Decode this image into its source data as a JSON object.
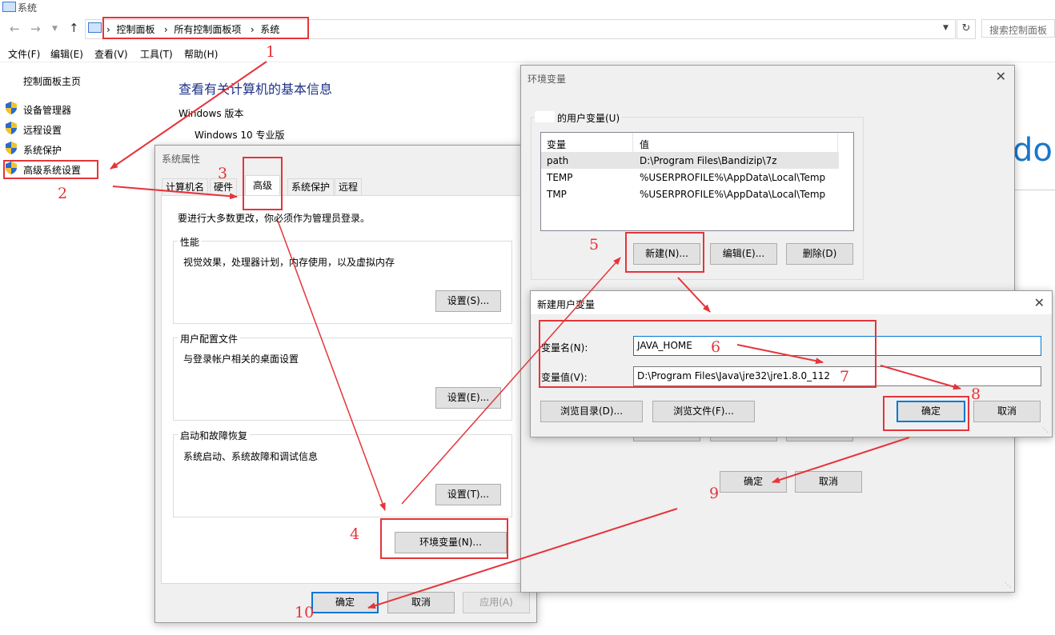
{
  "window": {
    "title": "系统",
    "breadcrumb": [
      "控制面板",
      "所有控制面板项",
      "系统"
    ],
    "search_placeholder": "搜索控制面板",
    "menu": [
      "文件(F)",
      "编辑(E)",
      "查看(V)",
      "工具(T)",
      "帮助(H)"
    ]
  },
  "sidebar": {
    "home": "控制面板主页",
    "links": [
      "设备管理器",
      "远程设置",
      "系统保护",
      "高级系统设置"
    ]
  },
  "main": {
    "heading": "查看有关计算机的基本信息",
    "section": "Windows 版本",
    "edition": "Windows 10 专业版",
    "brand_fragment": "do"
  },
  "system_properties": {
    "title": "系统属性",
    "tabs": [
      "计算机名",
      "硬件",
      "高级",
      "系统保护",
      "远程"
    ],
    "admin_note": "要进行大多数更改，你必须作为管理员登录。",
    "performance": {
      "label": "性能",
      "desc": "视觉效果，处理器计划，内存使用，以及虚拟内存",
      "button": "设置(S)..."
    },
    "profile": {
      "label": "用户配置文件",
      "desc": "与登录帐户相关的桌面设置",
      "button": "设置(E)..."
    },
    "startup": {
      "label": "启动和故障恢复",
      "desc": "系统启动、系统故障和调试信息",
      "button": "设置(T)..."
    },
    "env_button": "环境变量(N)...",
    "ok": "确定",
    "cancel": "取消",
    "apply": "应用(A)"
  },
  "env_vars": {
    "title": "环境变量",
    "user_group_label": "的用户变量(U)",
    "col_var": "变量",
    "col_val": "值",
    "rows": [
      {
        "var": "path",
        "val": "D:\\Program Files\\Bandizip\\7z"
      },
      {
        "var": "TEMP",
        "val": "%USERPROFILE%\\AppData\\Local\\Temp"
      },
      {
        "var": "TMP",
        "val": "%USERPROFILE%\\AppData\\Local\\Temp"
      }
    ],
    "new_btn": "新建(N)...",
    "edit_btn": "编辑(E)...",
    "delete_btn": "删除(D)",
    "ok": "确定",
    "cancel": "取消"
  },
  "new_var": {
    "title": "新建用户变量",
    "name_label": "变量名(N):",
    "value_label": "变量值(V):",
    "name_value": "JAVA_HOME",
    "value_value": "D:\\Program Files\\Java\\jre32\\jre1.8.0_112",
    "browse_dir": "浏览目录(D)...",
    "browse_file": "浏览文件(F)...",
    "ok": "确定",
    "cancel": "取消"
  },
  "annotations": {
    "step_numbers": [
      "1",
      "2",
      "3",
      "4",
      "5",
      "6",
      "7",
      "8",
      "9",
      "10"
    ],
    "color": "#e6343a"
  }
}
